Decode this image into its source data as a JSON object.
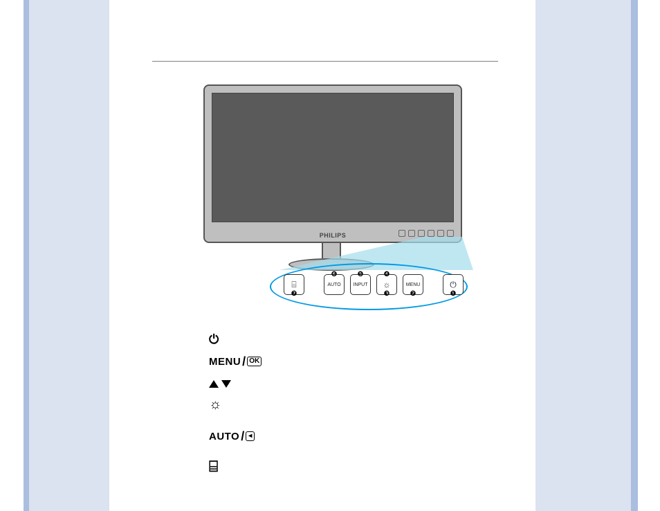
{
  "monitor": {
    "brand": "PHILIPS"
  },
  "callout": {
    "buttons": [
      {
        "label_type": "icon",
        "label": "⌸",
        "top_num": "",
        "bottom_num": "❼",
        "name": "smartimage-button"
      },
      {
        "label_type": "text",
        "label": "AUTO",
        "top_num": "❻",
        "bottom_num": "",
        "name": "auto-button"
      },
      {
        "label_type": "text",
        "label": "INPUT",
        "top_num": "❺",
        "bottom_num": "",
        "name": "input-button"
      },
      {
        "label_type": "icon",
        "label": "☼",
        "top_num": "❹",
        "bottom_num": "❸",
        "name": "brightness-button"
      },
      {
        "label_type": "text",
        "label": "MENU",
        "top_num": "",
        "bottom_num": "❷",
        "name": "menu-button"
      },
      {
        "label_type": "icon",
        "label": "⏻",
        "top_num": "",
        "bottom_num": "❶",
        "name": "power-button"
      }
    ]
  },
  "legend": {
    "power": {
      "name": "power-icon"
    },
    "menu_label": "MENU",
    "menu_ok": "OK",
    "arrows": {
      "name": "arrows-up-down-icon"
    },
    "brightness": {
      "name": "brightness-icon"
    },
    "auto_label": "AUTO",
    "auto_back": "◂",
    "smartimage": {
      "name": "smartimage-icon"
    }
  }
}
